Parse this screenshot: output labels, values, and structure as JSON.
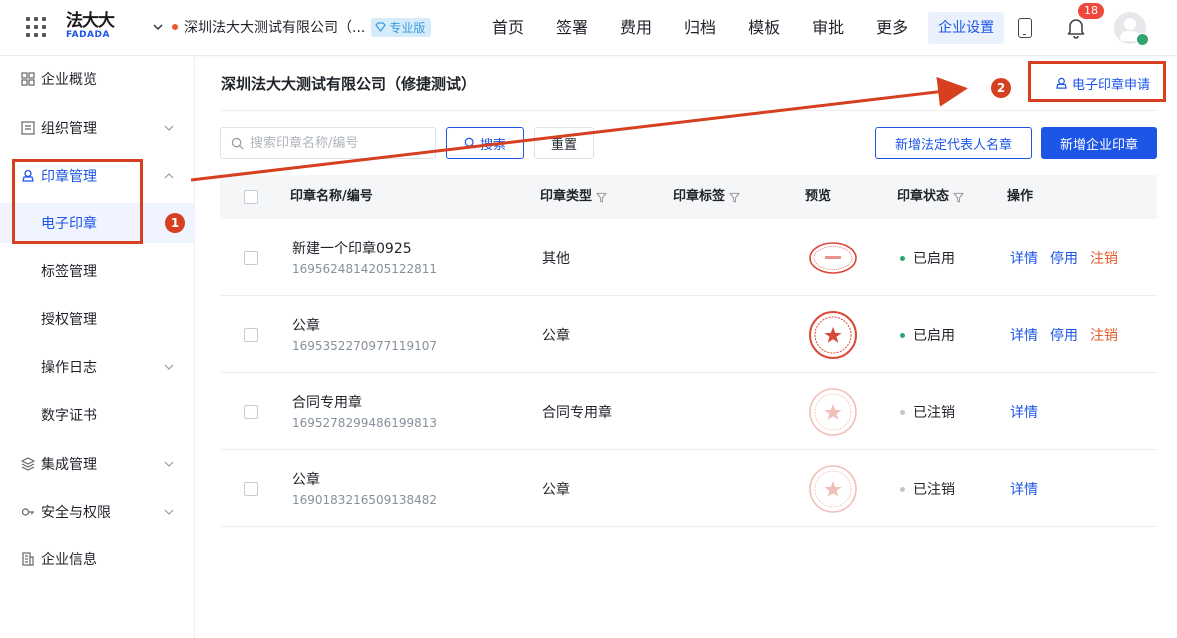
{
  "header": {
    "logo_cn": "法大大",
    "logo_en": "FADADA",
    "company_name": "深圳法大大测试有限公司（...",
    "edition_badge": "专业版",
    "nav": [
      "首页",
      "签署",
      "费用",
      "归档",
      "模板",
      "审批",
      "更多"
    ],
    "nav_active": "企业设置",
    "notification_count": "18"
  },
  "sidebar": {
    "items": [
      {
        "label": "企业概览"
      },
      {
        "label": "组织管理"
      },
      {
        "label": "印章管理"
      },
      {
        "label": "电子印章"
      },
      {
        "label": "标签管理"
      },
      {
        "label": "授权管理"
      },
      {
        "label": "操作日志"
      },
      {
        "label": "数字证书"
      },
      {
        "label": "集成管理"
      },
      {
        "label": "安全与权限"
      },
      {
        "label": "企业信息"
      }
    ]
  },
  "main": {
    "title": "深圳法大大测试有限公司（修捷测试）",
    "apply_link": "电子印章申请",
    "search_placeholder": "搜索印章名称/编号",
    "search_button": "搜索",
    "reset_button": "重置",
    "add_legal_button": "新增法定代表人名章",
    "add_seal_button": "新增企业印章",
    "columns": {
      "name": "印章名称/编号",
      "type": "印章类型",
      "tag": "印章标签",
      "preview": "预览",
      "status": "印章状态",
      "ops": "操作"
    },
    "rows": [
      {
        "name": "新建一个印章0925",
        "code": "1695624814205122811",
        "type": "其他",
        "status": "已启用",
        "ops": [
          "详情",
          "停用",
          "注销"
        ]
      },
      {
        "name": "公章",
        "code": "1695352270977119107",
        "type": "公章",
        "status": "已启用",
        "ops": [
          "详情",
          "停用",
          "注销"
        ]
      },
      {
        "name": "合同专用章",
        "code": "1695278299486199813",
        "type": "合同专用章",
        "status": "已注销",
        "ops": [
          "详情"
        ]
      },
      {
        "name": "公章",
        "code": "1690183216509138482",
        "type": "公章",
        "status": "已注销",
        "ops": [
          "详情"
        ]
      }
    ]
  },
  "annotations": {
    "step1": "1",
    "step2": "2"
  },
  "colors": {
    "primary": "#1d55e6",
    "danger": "#e8582b",
    "annotation": "#d63f1f",
    "enabled_dot": "#30a46c",
    "disabled_dot": "#c0c4cc"
  }
}
